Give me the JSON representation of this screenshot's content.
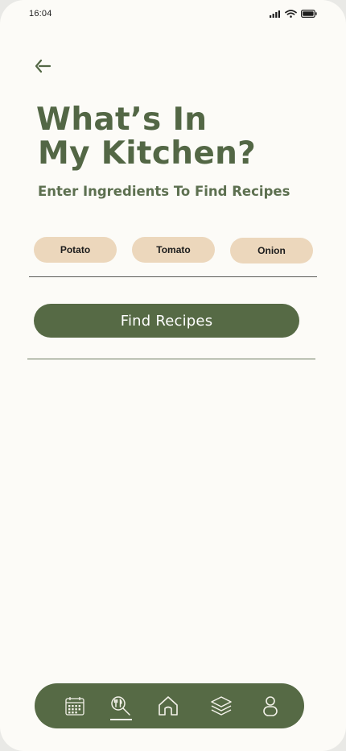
{
  "status_bar": {
    "time": "16:04",
    "icons": [
      "signal-icon",
      "wifi-icon",
      "battery-icon"
    ]
  },
  "header": {
    "back_icon": "back-arrow-icon",
    "title_line1": "What’s In",
    "title_line2": "My Kitchen?",
    "subtitle": "Enter Ingredients To Find Recipes"
  },
  "ingredients": [
    {
      "label": "Potato"
    },
    {
      "label": "Tomato"
    },
    {
      "label": "Onion"
    }
  ],
  "actions": {
    "find_label": "Find Recipes"
  },
  "bottom_nav": {
    "items": [
      {
        "icon": "calendar-icon",
        "active": false
      },
      {
        "icon": "recipe-search-icon",
        "active": true
      },
      {
        "icon": "home-icon",
        "active": false
      },
      {
        "icon": "layers-icon",
        "active": false
      },
      {
        "icon": "profile-icon",
        "active": false
      }
    ]
  },
  "colors": {
    "primary_green": "#566a45",
    "chip_beige": "#ecd7bc",
    "background": "#fcfbf7"
  }
}
